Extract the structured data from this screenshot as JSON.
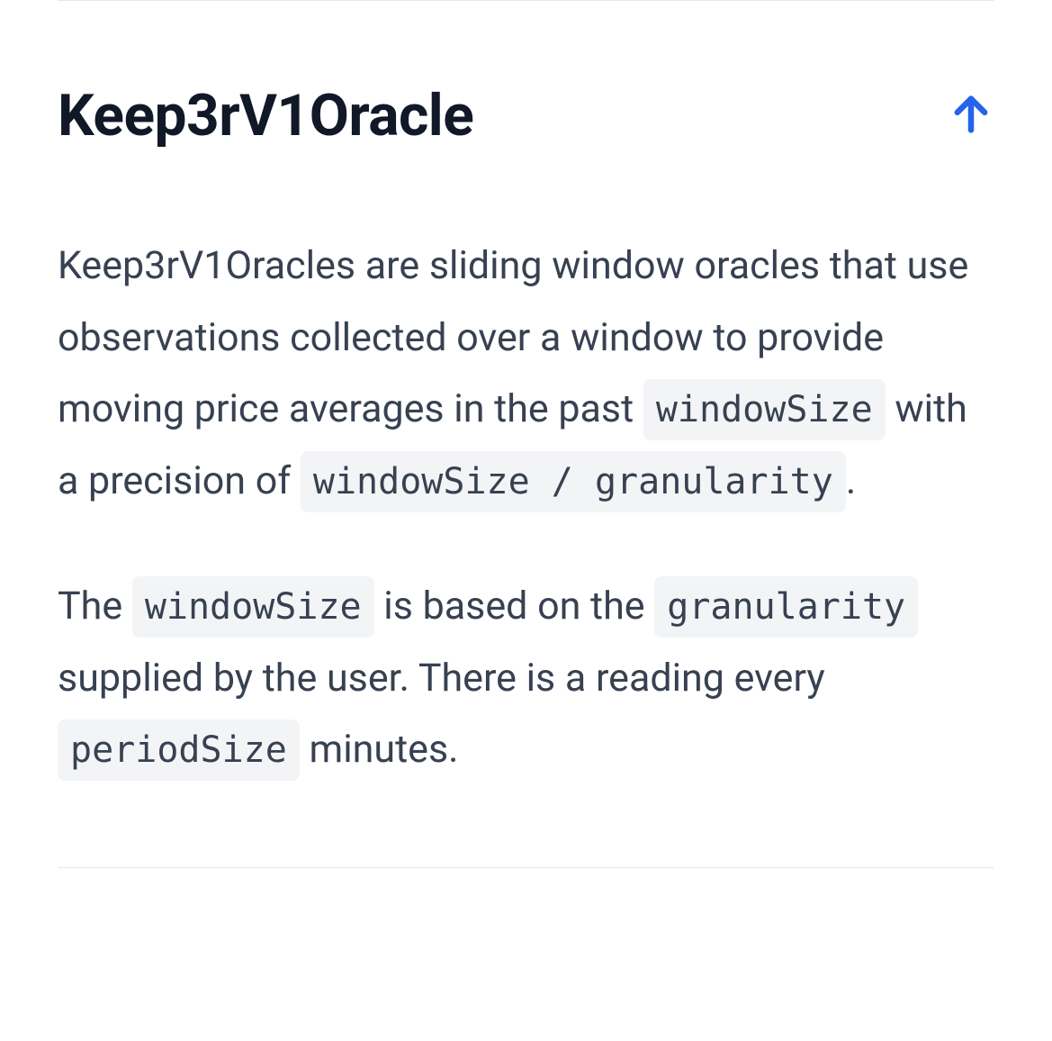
{
  "title": "Keep3rV1Oracle",
  "paragraphs": {
    "p1": {
      "t1": "Keep3rV1Oracles are sliding window oracles that use observations collected over a window to provide moving price averages in the past ",
      "code1": "windowSize",
      "t2": " with a precision of ",
      "code2": "windowSize / granularity",
      "t3": "."
    },
    "p2": {
      "t1": "The ",
      "code1": "windowSize",
      "t2": " is based on the ",
      "code2": "granularity",
      "t3": " supplied by the user. There is a reading every ",
      "code3": "periodSize",
      "t4": " minutes."
    }
  },
  "icons": {
    "upArrow": "arrow-up-icon"
  }
}
